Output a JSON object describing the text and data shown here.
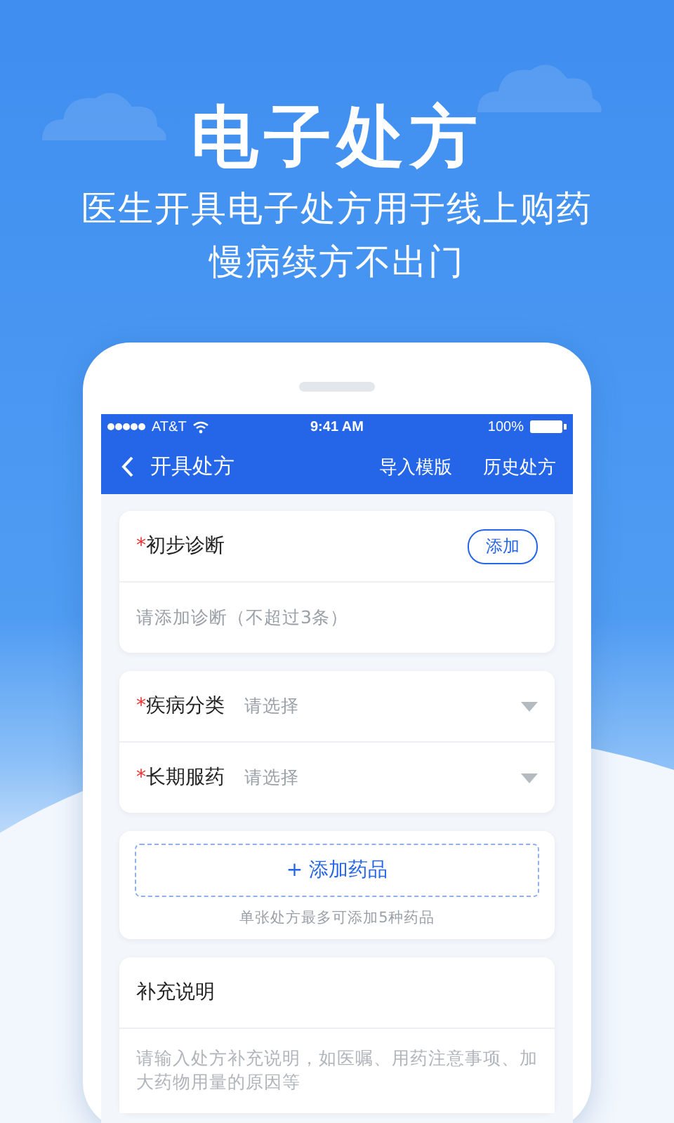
{
  "header": {
    "title": "电子处方",
    "subtitle_lines": [
      "医生开具电子处方用于线上购药",
      "慢病续方不出门"
    ]
  },
  "status_bar": {
    "carrier": "AT&T",
    "time": "9:41 AM",
    "battery": "100%"
  },
  "nav": {
    "title": "开具处方",
    "actions": [
      "导入模版",
      "历史处方"
    ]
  },
  "diagnosis": {
    "mark": "*",
    "label": "初步诊断",
    "button": "添加",
    "hint": "请添加诊断（不超过3条）"
  },
  "selects": [
    {
      "mark": "*",
      "label": "疾病分类",
      "placeholder": "请选择"
    },
    {
      "mark": "*",
      "label": "长期服药",
      "placeholder": "请选择"
    }
  ],
  "drugs": {
    "button": "+ 添加药品",
    "note": "单张处方最多可添加5种药品"
  },
  "notes": {
    "label": "补充说明",
    "placeholder": "请输入处方补充说明，如医嘱、用药注意事项、加大药物用量的原因等"
  }
}
